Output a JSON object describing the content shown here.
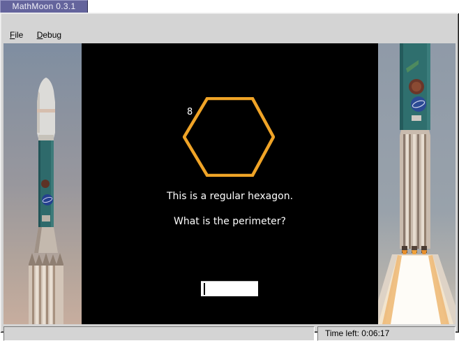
{
  "window": {
    "title": "MathMoon 0.3.1"
  },
  "menu": {
    "items": [
      {
        "label": "File"
      },
      {
        "label": "Debug"
      }
    ]
  },
  "game": {
    "shape": "regular hexagon",
    "side_label": "8",
    "question_line1": "This is a regular hexagon.",
    "question_line2": "What is the perimeter?",
    "answer_value": "",
    "colors": {
      "hexagon_stroke": "#f0a427",
      "panel_bg": "#000000",
      "text": "#ffffff",
      "titlebar_bg": "#64649c"
    }
  },
  "status": {
    "time_left": "Time left: 0:06:17"
  },
  "scene": {
    "left_photo": "rocket-on-pad-photo",
    "right_photo": "rocket-launch-flame-photo"
  }
}
